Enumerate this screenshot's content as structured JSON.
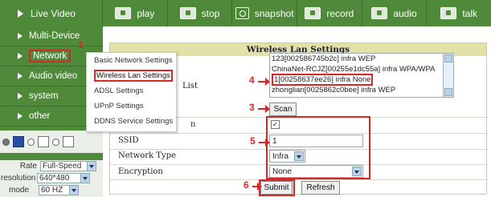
{
  "toolbar": {
    "live_video": "Live Video",
    "buttons": [
      {
        "label": "play",
        "icon": "play-icon"
      },
      {
        "label": "stop",
        "icon": "stop-icon"
      },
      {
        "label": "snapshot",
        "icon": "camera-icon"
      },
      {
        "label": "record",
        "icon": "record-icon"
      },
      {
        "label": "audio",
        "icon": "speaker-icon"
      },
      {
        "label": "talk",
        "icon": "microphone-icon"
      }
    ]
  },
  "sidebar": {
    "items": [
      {
        "label": "Multi-Device"
      },
      {
        "label": "Network"
      },
      {
        "label": "Audio video"
      },
      {
        "label": "system"
      },
      {
        "label": "other"
      }
    ]
  },
  "video_settings": {
    "rate_label": "Rate",
    "rate_value": "Full-Speed",
    "resolution_label": "resolution",
    "resolution_value": "640*480",
    "mode_label": "mode",
    "mode_value": "60 HZ"
  },
  "submenu": {
    "items": [
      {
        "label": "Basic Network Settings"
      },
      {
        "label": "Wireless Lan Settings"
      },
      {
        "label": "ADSL Settings"
      },
      {
        "label": "UPnP Settings"
      },
      {
        "label": "DDNS Service Settings"
      }
    ]
  },
  "wireless": {
    "title": "Wireless Lan Settings",
    "list_label": "List",
    "networks": [
      "123[002586745b2c] infra WEP",
      "ChinaNet-RCJZ[00255e1dc55a] infra WPA/WPA",
      "1[00258637ee26] infra None",
      "zhonglian[0025862c0bee] infra WEP"
    ],
    "scan_label": "Scan",
    "using_label": "n",
    "ssid_label": "SSID",
    "ssid_value": "1",
    "network_type_label": "Network Type",
    "network_type_value": "Infra",
    "encryption_label": "Encryption",
    "encryption_value": "None",
    "submit_label": "Submit",
    "refresh_label": "Refresh"
  },
  "annotations": [
    "1",
    "2",
    "3",
    "4",
    "5",
    "6"
  ],
  "colors": {
    "nav_green": "#4e8a39",
    "title_bar": "#e2e2a8",
    "highlight_red": "#d62828"
  }
}
